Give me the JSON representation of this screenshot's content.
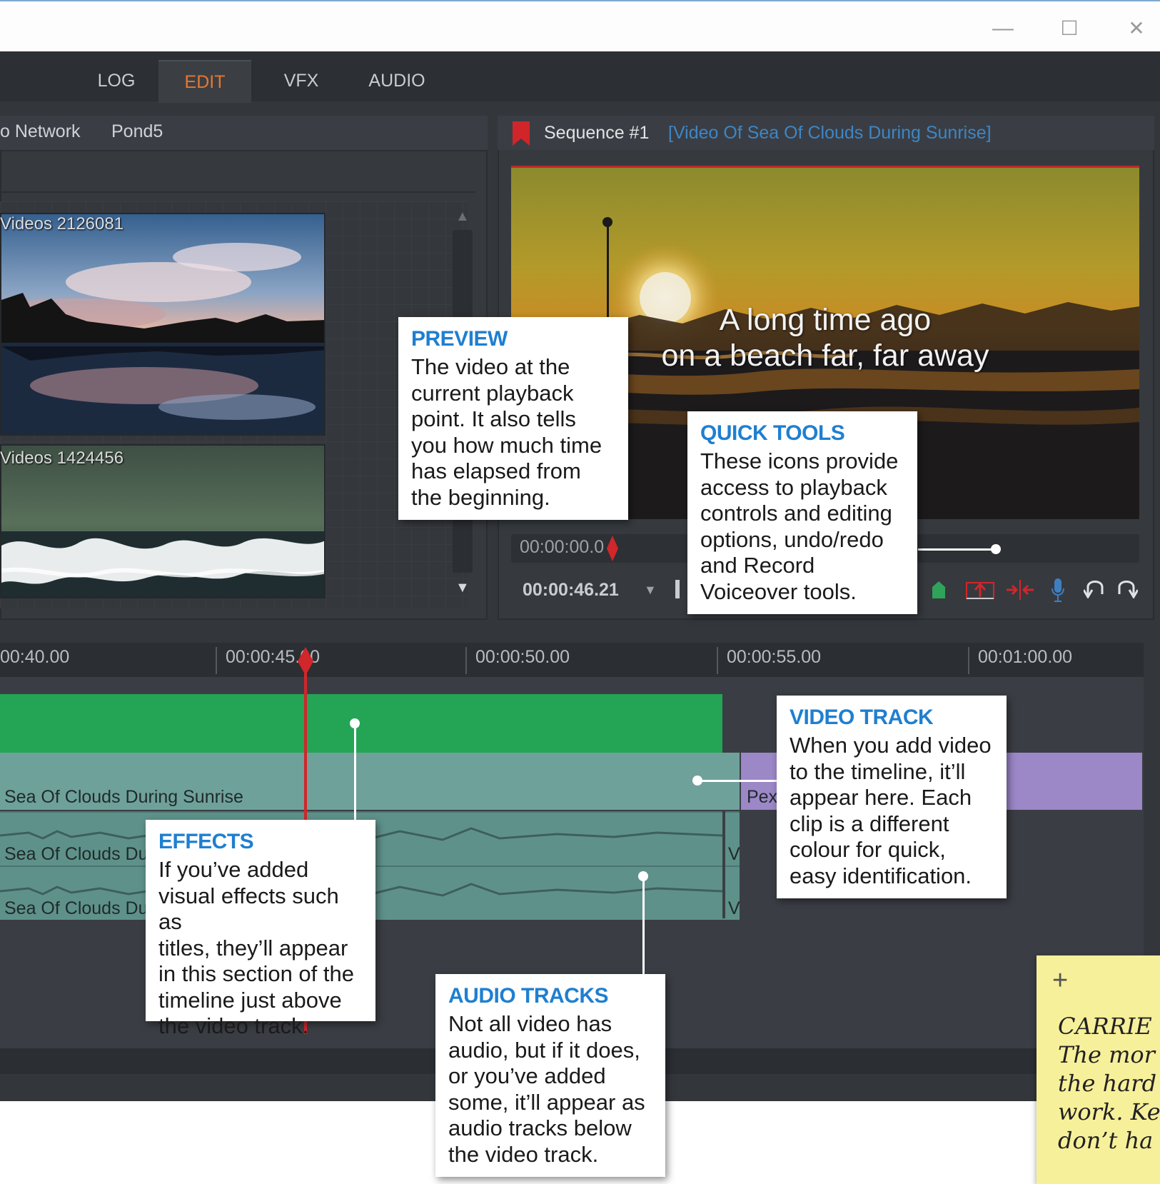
{
  "window": {
    "minimize": "—",
    "maximize": "☐",
    "close": "✕"
  },
  "tabs": [
    {
      "label": "LOG"
    },
    {
      "label": "EDIT",
      "active": true
    },
    {
      "label": "VFX"
    },
    {
      "label": "AUDIO"
    }
  ],
  "library": {
    "tabs": [
      "o Network",
      "Pond5"
    ],
    "thumbnails": [
      {
        "label": "Videos 2126081"
      },
      {
        "label": "Videos 1424456"
      }
    ]
  },
  "sequence": {
    "name": "Sequence #1",
    "clip_title": "[Video Of Sea Of Clouds During Sunrise]",
    "caption_line1": "A long time ago",
    "caption_line2": "on a beach far, far away",
    "scrub_time": "00:00:00.0",
    "duration": "00:00:46.21"
  },
  "timeline": {
    "ruler": [
      "00:40.00",
      "00:00:45.00",
      "00:00:50.00",
      "00:00:55.00",
      "00:01:00.00"
    ],
    "video_clip_label": "Sea Of Clouds During Sunrise",
    "video_clip2_label": "Pex",
    "audio_clip1_label": "Sea Of Clouds Du",
    "audio_clip2_label": "Sea Of Clouds Du",
    "audio_tail_label": "V"
  },
  "callouts": {
    "preview": {
      "title": "PREVIEW",
      "lines": [
        "The video at the",
        "current playback",
        "point. It also tells",
        "you how much time",
        "has elapsed from",
        "the beginning."
      ]
    },
    "quick_tools": {
      "title": "QUICK TOOLS",
      "lines": [
        "These icons provide",
        "access to playback",
        "controls and editing",
        "options, undo/redo",
        "and Record",
        "Voiceover tools."
      ]
    },
    "video_track": {
      "title": "VIDEO TRACK",
      "lines": [
        "When you add video",
        "to the timeline, it’ll",
        "appear here. Each",
        "clip is a different",
        "colour for quick,",
        "easy identification."
      ]
    },
    "effects": {
      "title": "EFFECTS",
      "lines": [
        "If you’ve added",
        "visual effects such as",
        "titles, they’ll appear",
        "in this section of the",
        "timeline just above",
        "the video track."
      ]
    },
    "audio_tracks": {
      "title": "AUDIO TRACKS",
      "lines": [
        "Not all video has",
        "audio, but if it does,",
        "or you’ve added",
        "some, it’ll appear as",
        "audio tracks below",
        "the video track."
      ]
    }
  },
  "note": {
    "plus": "+",
    "lines": [
      "CARRIE",
      "The mor",
      "the hard",
      "work. Ke",
      "don’t ha"
    ]
  },
  "colors": {
    "accent_orange": "#e8772e",
    "callout_blue": "#1f7fd0",
    "effects_green": "#23a555",
    "video_teal": "#6fa19b",
    "video_purple": "#9c87c7",
    "playhead_red": "#d1262a"
  }
}
